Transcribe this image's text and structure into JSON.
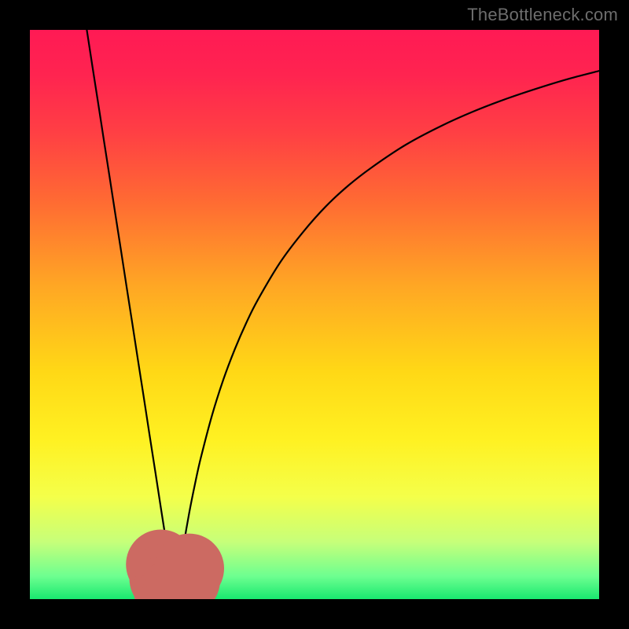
{
  "watermark": "TheBottleneck.com",
  "gradient": {
    "stops": [
      {
        "offset": 0.0,
        "color": "#ff1a54"
      },
      {
        "offset": 0.08,
        "color": "#ff2450"
      },
      {
        "offset": 0.18,
        "color": "#ff3f44"
      },
      {
        "offset": 0.3,
        "color": "#ff6a33"
      },
      {
        "offset": 0.45,
        "color": "#ffa724"
      },
      {
        "offset": 0.6,
        "color": "#ffd816"
      },
      {
        "offset": 0.72,
        "color": "#fff122"
      },
      {
        "offset": 0.82,
        "color": "#f4ff4a"
      },
      {
        "offset": 0.9,
        "color": "#c6ff7a"
      },
      {
        "offset": 0.96,
        "color": "#6dff90"
      },
      {
        "offset": 1.0,
        "color": "#19e86f"
      }
    ]
  },
  "chart_data": {
    "type": "line",
    "title": "",
    "xlabel": "",
    "ylabel": "",
    "xlim": [
      0,
      100
    ],
    "ylim": [
      0,
      100
    ],
    "grid": false,
    "notch_x": 25.5,
    "series": [
      {
        "name": "curve",
        "x": [
          10.0,
          11.0,
          12.0,
          13.0,
          14.0,
          15.0,
          16.0,
          17.0,
          18.0,
          19.0,
          20.0,
          21.0,
          22.0,
          23.0,
          24.0,
          25.0,
          25.5,
          26.0,
          27.0,
          28.0,
          29.0,
          30.0,
          32.0,
          34.0,
          36.0,
          38.0,
          40.0,
          44.0,
          48.0,
          52.0,
          56.0,
          60.0,
          66.0,
          72.0,
          78.0,
          84.0,
          90.0,
          95.0,
          100.0
        ],
        "values": [
          100.0,
          93.5,
          87.1,
          80.6,
          74.2,
          67.7,
          61.3,
          54.8,
          48.4,
          41.9,
          35.5,
          29.0,
          22.6,
          16.1,
          9.7,
          3.2,
          0.0,
          2.6,
          9.4,
          15.2,
          20.2,
          24.7,
          32.3,
          38.6,
          43.9,
          48.5,
          52.5,
          59.2,
          64.5,
          69.0,
          72.7,
          75.8,
          79.8,
          83.0,
          85.7,
          88.0,
          90.0,
          91.5,
          92.8
        ]
      }
    ],
    "marker_cluster": {
      "points_x": [
        23.0,
        23.6,
        24.3,
        25.0,
        25.8,
        26.6,
        27.3,
        28.0
      ],
      "points_y": [
        6.1,
        3.6,
        1.8,
        0.8,
        0.7,
        1.7,
        3.3,
        5.4
      ],
      "radius": 1.8,
      "color": "#cc6a62"
    }
  }
}
